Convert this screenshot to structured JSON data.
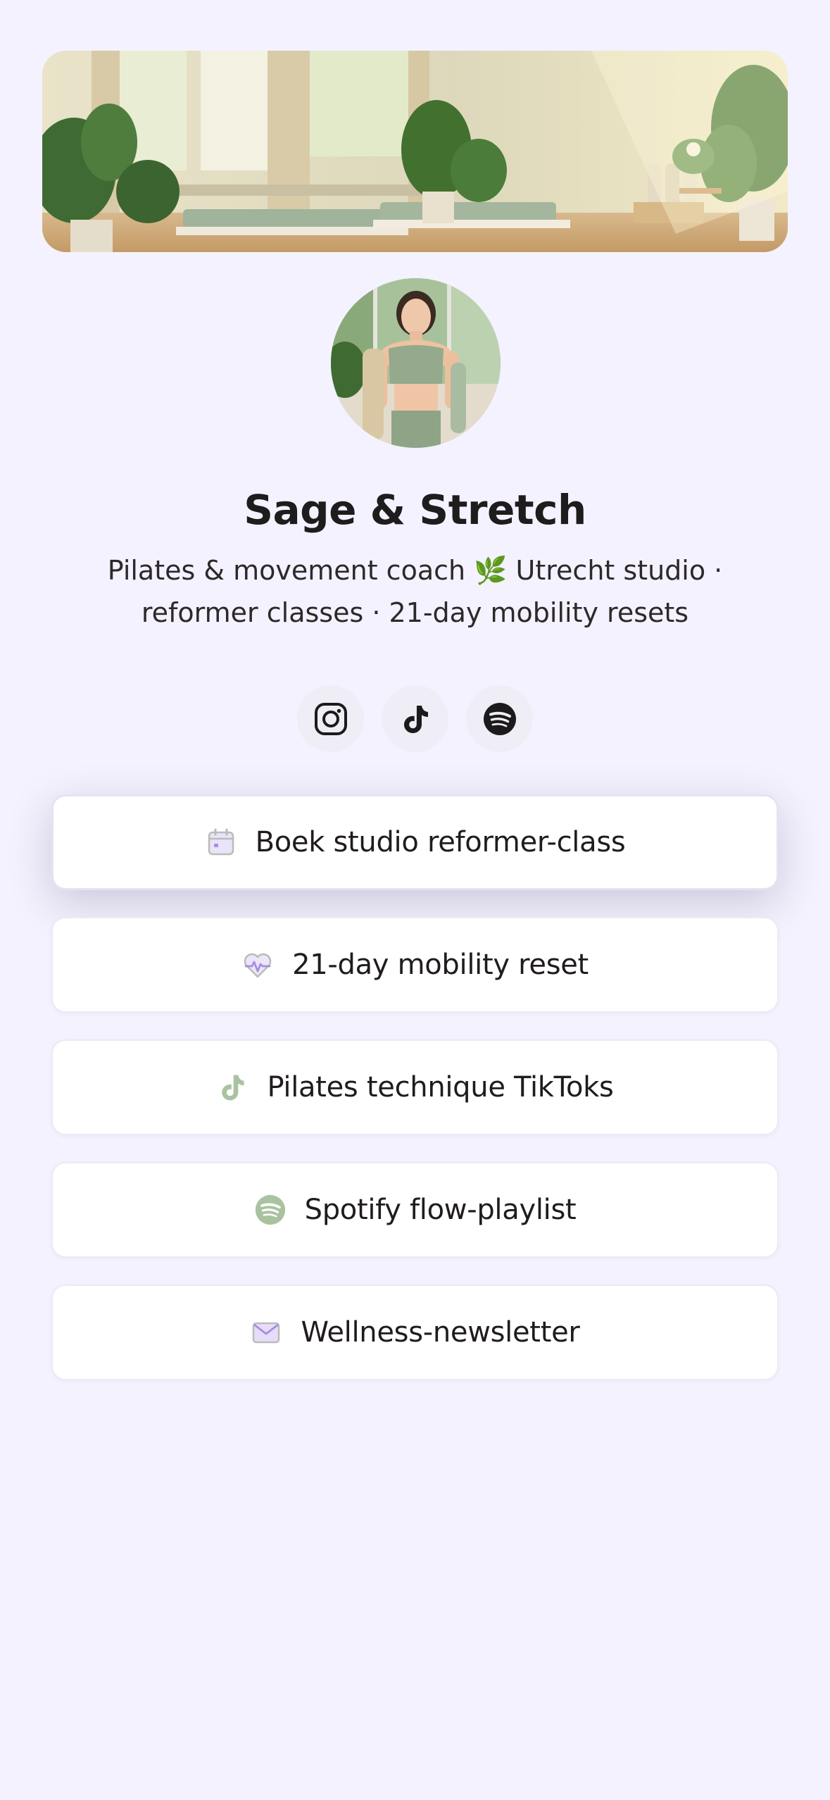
{
  "profile": {
    "name": "Sage & Stretch",
    "bio": "Pilates & movement coach 🌿  Utrecht studio · reformer classes · 21-day mobility resets"
  },
  "socials": [
    {
      "icon": "instagram-icon"
    },
    {
      "icon": "tiktok-icon"
    },
    {
      "icon": "spotify-icon"
    }
  ],
  "links": [
    {
      "label": "Boek studio reformer-class",
      "icon": "calendar-icon"
    },
    {
      "label": "21-day mobility reset",
      "icon": "heart-pulse-icon"
    },
    {
      "label": "Pilates technique TikToks",
      "icon": "tiktok-icon"
    },
    {
      "label": "Spotify flow-playlist",
      "icon": "spotify-icon"
    },
    {
      "label": "Wellness-newsletter",
      "icon": "mail-icon"
    }
  ],
  "colors": {
    "background": "#f4f2fe",
    "accent_sage": "#a9c3a0",
    "accent_lavender": "#c8b8f0",
    "text": "#231f20"
  }
}
